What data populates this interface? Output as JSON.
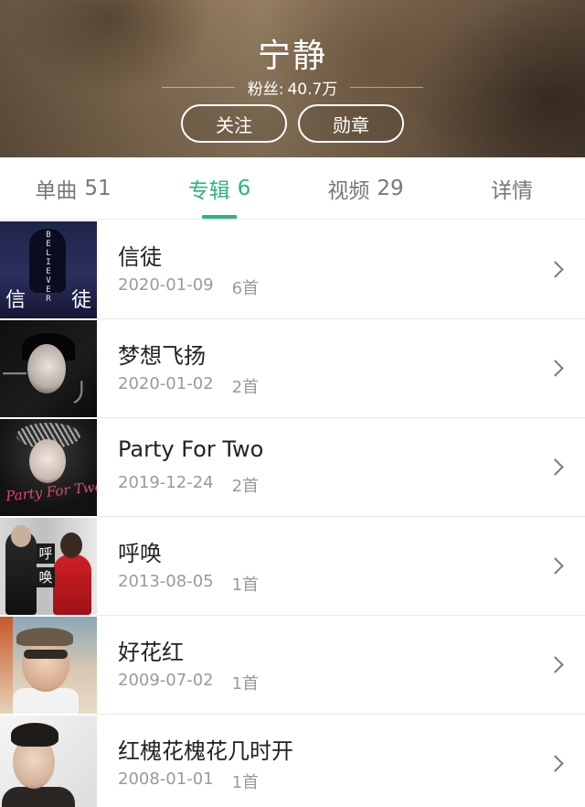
{
  "artist": {
    "name": "宁静",
    "fans_label": "粉丝:",
    "fans_count": "40.7万",
    "follow_label": "关注",
    "medal_label": "勋章"
  },
  "tabs": [
    {
      "label": "单曲",
      "count": "51",
      "active": false
    },
    {
      "label": "专辑",
      "count": "6",
      "active": true
    },
    {
      "label": "视频",
      "count": "29",
      "active": false
    },
    {
      "label": "详情",
      "count": "",
      "active": false
    }
  ],
  "albums": [
    {
      "title": "信徒",
      "date": "2020-01-09",
      "tracks": "6首",
      "cover_text": [
        "信",
        "徒",
        "BELIEVER"
      ]
    },
    {
      "title": "梦想飞扬",
      "date": "2020-01-02",
      "tracks": "2首"
    },
    {
      "title": "Party For Two",
      "date": "2019-12-24",
      "tracks": "2首",
      "cover_text": [
        "Party For Two"
      ]
    },
    {
      "title": "呼唤",
      "date": "2013-08-05",
      "tracks": "1首",
      "cover_text": [
        "呼",
        "唤"
      ]
    },
    {
      "title": "好花红",
      "date": "2009-07-02",
      "tracks": "1首"
    },
    {
      "title": "红槐花槐花几时开",
      "date": "2008-01-01",
      "tracks": "1首"
    }
  ],
  "colors": {
    "accent": "#2fb37e",
    "tab_inactive": "#777777",
    "meta_text": "#9a9a9a"
  },
  "icons": {
    "row_chevron": "chevron-right-icon"
  }
}
